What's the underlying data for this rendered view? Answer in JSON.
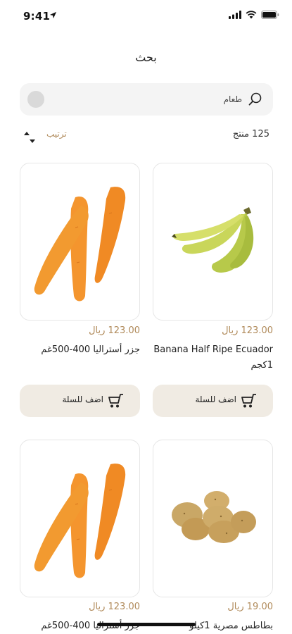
{
  "status": {
    "time": "9:41"
  },
  "header": {
    "title": "بحث"
  },
  "search": {
    "value": "طعام"
  },
  "toolbar": {
    "results_count": "125 منتج",
    "sort_label": "ترتيب"
  },
  "products": [
    {
      "price": "123.00 ريال",
      "name": "Banana Half Ripe Ecuador 1كجم",
      "image": "banana",
      "add_label": "اضف للسلة"
    },
    {
      "price": "123.00 ريال",
      "name": "جزر أستراليا 400-500غم",
      "image": "carrot",
      "add_label": "اضف للسلة"
    },
    {
      "price": "19.00 ريال",
      "name": "بطاطس مصرية 1كيلو",
      "image": "potato"
    },
    {
      "price": "123.00 ريال",
      "name": "جزر أستراليا 400-500غم",
      "image": "carrot"
    }
  ],
  "colors": {
    "accent": "#b08a5a",
    "button_bg": "#f0ebe3",
    "search_bg": "#f4f4f4"
  }
}
